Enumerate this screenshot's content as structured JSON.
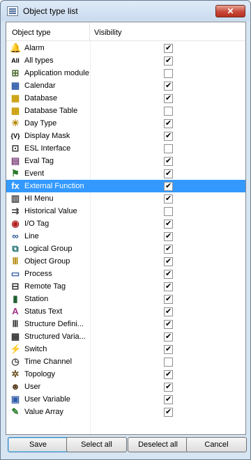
{
  "window": {
    "title": "Object type list",
    "close_label": "✕"
  },
  "table": {
    "columns": [
      "Object type",
      "Visibility"
    ],
    "rows": [
      {
        "name": "Alarm",
        "icon": "alarm-icon",
        "glyph": "🔔",
        "color": "#c0392b",
        "visible": true,
        "selected": false
      },
      {
        "name": "All types",
        "icon": "all-types-icon",
        "glyph": "All",
        "color": "#000000",
        "visible": true,
        "selected": false
      },
      {
        "name": "Application module",
        "icon": "application-module-icon",
        "glyph": "⊞",
        "color": "#4a6a2a",
        "visible": false,
        "selected": false
      },
      {
        "name": "Calendar",
        "icon": "calendar-icon",
        "glyph": "▦",
        "color": "#2f5ca8",
        "visible": true,
        "selected": false
      },
      {
        "name": "Database",
        "icon": "database-icon",
        "glyph": "▦",
        "color": "#c89b00",
        "visible": true,
        "selected": false
      },
      {
        "name": "Database Table",
        "icon": "database-table-icon",
        "glyph": "▦",
        "color": "#c89b00",
        "visible": false,
        "selected": false
      },
      {
        "name": "Day Type",
        "icon": "day-type-icon",
        "glyph": "☀",
        "color": "#b38600",
        "visible": true,
        "selected": false
      },
      {
        "name": "Display Mask",
        "icon": "display-mask-icon",
        "glyph": "{V}",
        "color": "#000000",
        "visible": true,
        "selected": false
      },
      {
        "name": "ESL Interface",
        "icon": "esl-interface-icon",
        "glyph": "⊡",
        "color": "#333333",
        "visible": false,
        "selected": false
      },
      {
        "name": "Eval Tag",
        "icon": "eval-tag-icon",
        "glyph": "▤",
        "color": "#7a3f7a",
        "visible": true,
        "selected": false
      },
      {
        "name": "Event",
        "icon": "event-icon",
        "glyph": "⚑",
        "color": "#2a7a2a",
        "visible": true,
        "selected": false
      },
      {
        "name": "External Function",
        "icon": "external-function-icon",
        "glyph": "fx",
        "color": "#000000",
        "visible": true,
        "selected": true
      },
      {
        "name": "HI Menu",
        "icon": "hi-menu-icon",
        "glyph": "▥",
        "color": "#444444",
        "visible": true,
        "selected": false
      },
      {
        "name": "Historical Value",
        "icon": "historical-value-icon",
        "glyph": "⇉",
        "color": "#444444",
        "visible": false,
        "selected": false
      },
      {
        "name": "I/O Tag",
        "icon": "io-tag-icon",
        "glyph": "◉",
        "color": "#b02020",
        "visible": true,
        "selected": false
      },
      {
        "name": "Line",
        "icon": "line-icon",
        "glyph": "∞",
        "color": "#1f4f8f",
        "visible": true,
        "selected": false
      },
      {
        "name": "Logical Group",
        "icon": "logical-group-icon",
        "glyph": "⧉",
        "color": "#1f6f6f",
        "visible": true,
        "selected": false
      },
      {
        "name": "Object Group",
        "icon": "object-group-icon",
        "glyph": "Ⅲ",
        "color": "#b38600",
        "visible": true,
        "selected": false
      },
      {
        "name": "Process",
        "icon": "process-icon",
        "glyph": "▭",
        "color": "#2f5ca8",
        "visible": true,
        "selected": false
      },
      {
        "name": "Remote Tag",
        "icon": "remote-tag-icon",
        "glyph": "⊟",
        "color": "#333333",
        "visible": true,
        "selected": false
      },
      {
        "name": "Station",
        "icon": "station-icon",
        "glyph": "▮",
        "color": "#1f5f2f",
        "visible": true,
        "selected": false
      },
      {
        "name": "Status Text",
        "icon": "status-text-icon",
        "glyph": "A",
        "color": "#a0308a",
        "visible": true,
        "selected": false
      },
      {
        "name": "Structure Defini...",
        "icon": "structure-definition-icon",
        "glyph": "Ⅲ",
        "color": "#333333",
        "visible": true,
        "selected": false
      },
      {
        "name": "Structured Varia...",
        "icon": "structured-variable-icon",
        "glyph": "▦",
        "color": "#333333",
        "visible": true,
        "selected": false
      },
      {
        "name": "Switch",
        "icon": "switch-icon",
        "glyph": "⚡",
        "color": "#b38600",
        "visible": true,
        "selected": false
      },
      {
        "name": "Time Channel",
        "icon": "time-channel-icon",
        "glyph": "◷",
        "color": "#444444",
        "visible": false,
        "selected": false
      },
      {
        "name": "Topology",
        "icon": "topology-icon",
        "glyph": "✲",
        "color": "#6a4f1f",
        "visible": true,
        "selected": false
      },
      {
        "name": "User",
        "icon": "user-icon",
        "glyph": "☻",
        "color": "#5a3f1f",
        "visible": true,
        "selected": false
      },
      {
        "name": "User Variable",
        "icon": "user-variable-icon",
        "glyph": "▣",
        "color": "#2f5ca8",
        "visible": true,
        "selected": false
      },
      {
        "name": "Value Array",
        "icon": "value-array-icon",
        "glyph": "✎",
        "color": "#2a7a2a",
        "visible": true,
        "selected": false
      }
    ]
  },
  "buttons": {
    "save": "Save",
    "select_all": "Select all",
    "deselect_all": "Deselect all",
    "cancel": "Cancel"
  },
  "colors": {
    "selection": "#3399ff"
  }
}
